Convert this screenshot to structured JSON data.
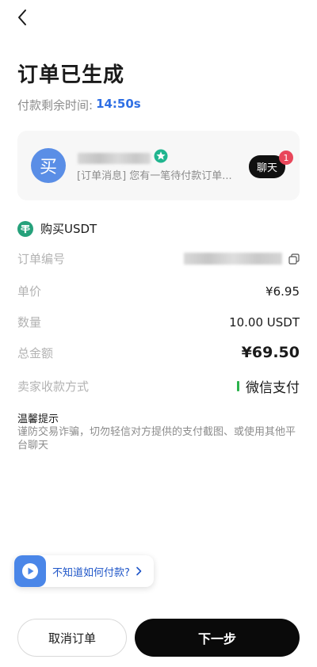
{
  "header": {
    "title": "订单已生成",
    "timer_label": "付款剩余时间:",
    "timer_value": "14:50s"
  },
  "seller": {
    "avatar_text": "买",
    "message": "[订单消息] 您有一笔待付款订单...",
    "chat_label": "聊天",
    "unread_count": "1"
  },
  "product": {
    "label": "购买USDT"
  },
  "details": {
    "order_no_label": "订单编号",
    "price_label": "单价",
    "price_value": "¥6.95",
    "quantity_label": "数量",
    "quantity_value": "10.00 USDT",
    "total_label": "总金额",
    "total_value": "¥69.50",
    "pay_method_label": "卖家收款方式",
    "pay_method_value": "微信支付"
  },
  "tips": {
    "title": "温馨提示",
    "text": "谨防交易诈骗，切勿轻信对方提供的支付截图、或使用其他平台聊天"
  },
  "help": {
    "label": "不知道如何付款?"
  },
  "actions": {
    "cancel_label": "取消订单",
    "next_label": "下一步"
  },
  "colors": {
    "accent_blue": "#2f6fe4",
    "usdt_green": "#26a17b",
    "wechat_green": "#2bb24c",
    "badge_red": "#e8465a"
  }
}
